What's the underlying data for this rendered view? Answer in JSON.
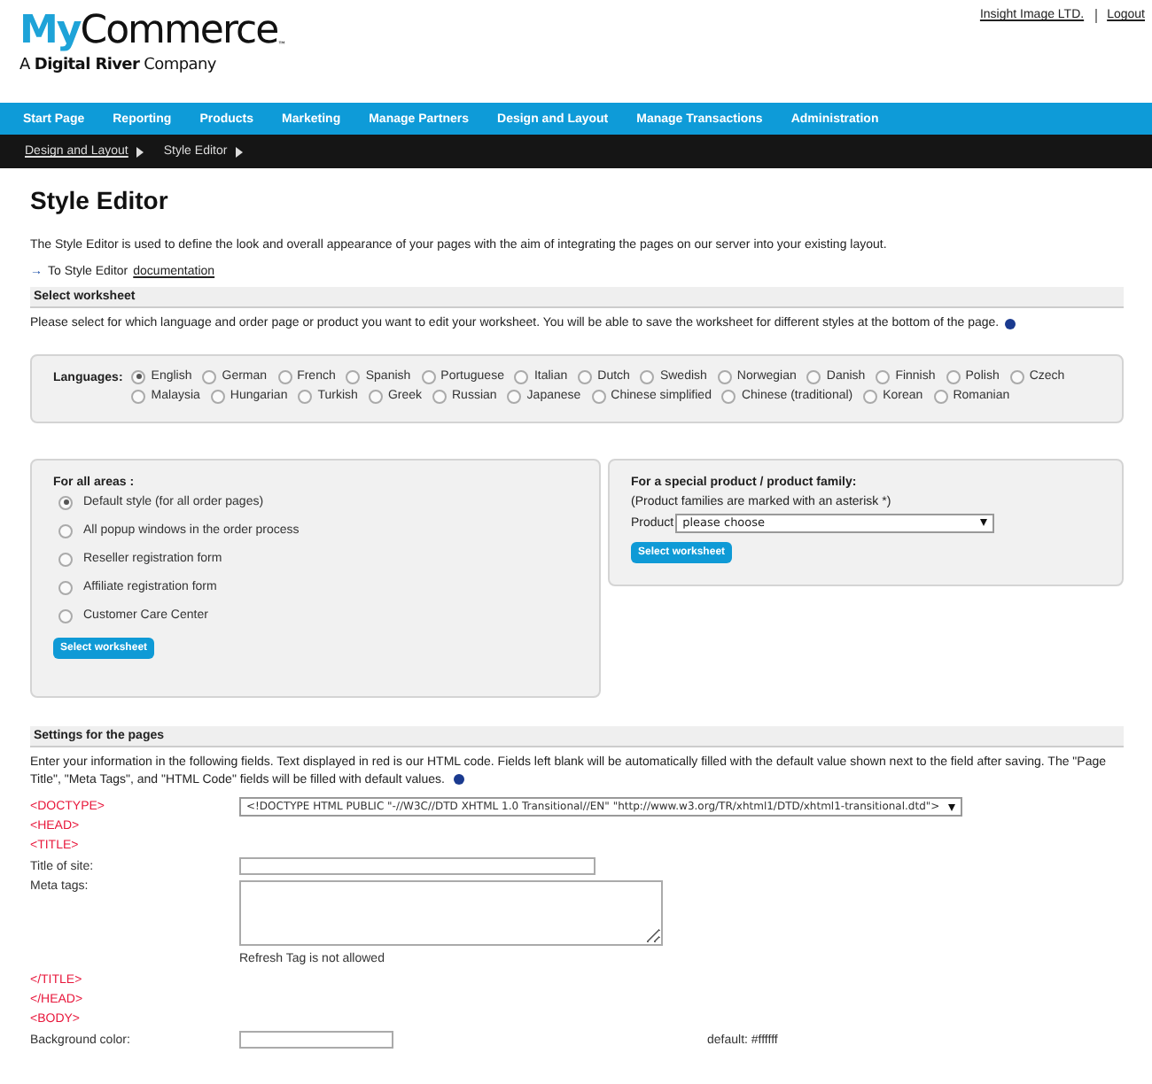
{
  "logo": {
    "brand_part_1": "My",
    "brand_part_2": "Commerce",
    "trademark": "™",
    "tagline": "A **Digital River** Company"
  },
  "account": {
    "company": "Insight Image LTD.",
    "logout": "Logout"
  },
  "nav": [
    {
      "label": "Start Page"
    },
    {
      "label": "Reporting"
    },
    {
      "label": "Products"
    },
    {
      "label": "Marketing"
    },
    {
      "label": "Manage Partners"
    },
    {
      "label": "Design and Layout"
    },
    {
      "label": "Manage Transactions"
    },
    {
      "label": "Administration"
    }
  ],
  "breadcrumb": [
    {
      "label": "Design and Layout",
      "kind": "link"
    },
    {
      "label": "Style Editor",
      "kind": "current"
    }
  ],
  "title": "Style Editor",
  "intro": "The Style Editor is used to define the look and overall appearance of your pages with the aim of integrating the pages on our server into your existing layout.",
  "doc_link": {
    "arrow": "→",
    "prefix": "To Style Editor",
    "link": "documentation"
  },
  "select_section": {
    "heading": "Select worksheet",
    "help": "Please select for which language and order page or product you want to edit your worksheet. You will be able to save the worksheet for different styles at the bottom of the page."
  },
  "languages": {
    "label": "Languages:",
    "options": [
      {
        "label": "English",
        "selected": true
      },
      {
        "label": "German",
        "selected": false
      },
      {
        "label": "French",
        "selected": false
      },
      {
        "label": "Spanish",
        "selected": false
      },
      {
        "label": "Portuguese",
        "selected": false
      },
      {
        "label": "Italian",
        "selected": false
      },
      {
        "label": "Dutch",
        "selected": false
      },
      {
        "label": "Swedish",
        "selected": false
      },
      {
        "label": "Norwegian",
        "selected": false
      },
      {
        "label": "Danish",
        "selected": false
      },
      {
        "label": "Finnish",
        "selected": false
      },
      {
        "label": "Polish",
        "selected": false
      },
      {
        "label": "Czech",
        "selected": false
      },
      {
        "label": "Malaysia",
        "selected": false
      },
      {
        "label": "Hungarian",
        "selected": false
      },
      {
        "label": "Turkish",
        "selected": false
      },
      {
        "label": "Greek",
        "selected": false
      },
      {
        "label": "Russian",
        "selected": false
      },
      {
        "label": "Japanese",
        "selected": false
      },
      {
        "label": "Chinese simplified",
        "selected": false
      },
      {
        "label": "Chinese (traditional)",
        "selected": false
      },
      {
        "label": "Korean",
        "selected": false
      },
      {
        "label": "Romanian",
        "selected": false
      }
    ]
  },
  "all_areas": {
    "heading": "For all areas :",
    "options": [
      {
        "label": "Default style (for all order pages)",
        "selected": true
      },
      {
        "label": "All popup windows in the order process",
        "selected": false
      },
      {
        "label": "Reseller registration form",
        "selected": false
      },
      {
        "label": "Affiliate registration form",
        "selected": false
      },
      {
        "label": "Customer Care Center",
        "selected": false
      }
    ],
    "button": "Select worksheet"
  },
  "special_product": {
    "heading": "For a special product / product family:",
    "note": "(Product families are marked with an asterisk *)",
    "field_label": "Product",
    "select_value": "please choose",
    "button": "Select worksheet"
  },
  "settings": {
    "heading": "Settings for the pages",
    "help": "Enter your information in the following fields. Text displayed in red is our HTML code. Fields left blank will be automatically filled with the default value shown next to the field after saving. The \"Page Title\", \"Meta Tags\", and \"HTML Code\" fields will be filled with default values.",
    "rows": [
      {
        "kind": "select",
        "label": "<DOCTYPE>",
        "value": "<!DOCTYPE HTML PUBLIC \"-//W3C//DTD XHTML 1.0 Transitional//EN\" \"http://www.w3.org/TR/xhtml1/DTD/xhtml1-transitional.dtd\">"
      },
      {
        "kind": "code",
        "label": "<HEAD>"
      },
      {
        "kind": "code",
        "label": "<TITLE>"
      },
      {
        "kind": "text",
        "label": "Title of site:"
      },
      {
        "kind": "textarea",
        "label": "Meta tags:",
        "note": "Refresh Tag is not allowed"
      },
      {
        "kind": "code",
        "label": "</TITLE>"
      },
      {
        "kind": "code",
        "label": "</HEAD>"
      },
      {
        "kind": "code",
        "label": "<BODY>"
      },
      {
        "kind": "color",
        "label": "Background color:",
        "default": "default: #ffffff"
      }
    ]
  }
}
